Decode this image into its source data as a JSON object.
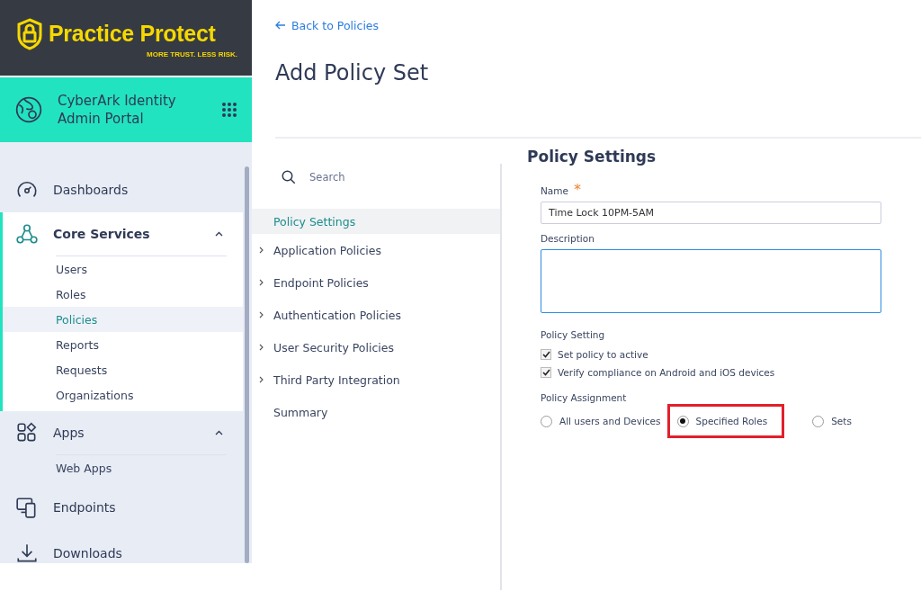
{
  "brand": {
    "name": "Practice Protect",
    "tagline": "MORE TRUST. LESS RISK."
  },
  "portal": {
    "title_line1": "CyberArk Identity",
    "title_line2": "Admin Portal"
  },
  "nav": [
    {
      "kind": "item",
      "label": "Dashboards"
    },
    {
      "kind": "group",
      "label": "Core Services",
      "expanded": true,
      "children": [
        {
          "label": "Users",
          "selected": false
        },
        {
          "label": "Roles",
          "selected": false
        },
        {
          "label": "Policies",
          "selected": true
        },
        {
          "label": "Reports",
          "selected": false
        },
        {
          "label": "Requests",
          "selected": false
        },
        {
          "label": "Organizations",
          "selected": false
        }
      ]
    },
    {
      "kind": "group",
      "label": "Apps",
      "expanded": true,
      "children": [
        {
          "label": "Web Apps",
          "selected": false
        }
      ]
    },
    {
      "kind": "item",
      "label": "Endpoints"
    },
    {
      "kind": "item",
      "label": "Downloads"
    }
  ],
  "back_link": "Back to Policies",
  "page_title": "Add Policy Set",
  "search": {
    "placeholder": "Search"
  },
  "sections": [
    {
      "label": "Policy Settings",
      "selected": true,
      "expandable": false
    },
    {
      "label": "Application Policies",
      "selected": false,
      "expandable": true
    },
    {
      "label": "Endpoint Policies",
      "selected": false,
      "expandable": true
    },
    {
      "label": "Authentication Policies",
      "selected": false,
      "expandable": true
    },
    {
      "label": "User Security Policies",
      "selected": false,
      "expandable": true
    },
    {
      "label": "Third Party Integration",
      "selected": false,
      "expandable": true
    },
    {
      "label": "Summary",
      "selected": false,
      "expandable": false
    }
  ],
  "form": {
    "heading": "Policy Settings",
    "name_label": "Name",
    "name_required": "*",
    "name_value": "Time Lock 10PM-5AM",
    "description_label": "Description",
    "setting_label": "Policy Setting",
    "checkboxes": [
      {
        "label": "Set policy to active",
        "checked": true
      },
      {
        "label": "Verify compliance on Android and iOS devices",
        "checked": true
      }
    ],
    "assignment_label": "Policy Assignment",
    "radios": [
      {
        "label": "All users and Devices",
        "selected": false,
        "highlighted": false
      },
      {
        "label": "Specified Roles",
        "selected": true,
        "highlighted": true
      },
      {
        "label": "Sets",
        "selected": false,
        "highlighted": false
      }
    ]
  }
}
